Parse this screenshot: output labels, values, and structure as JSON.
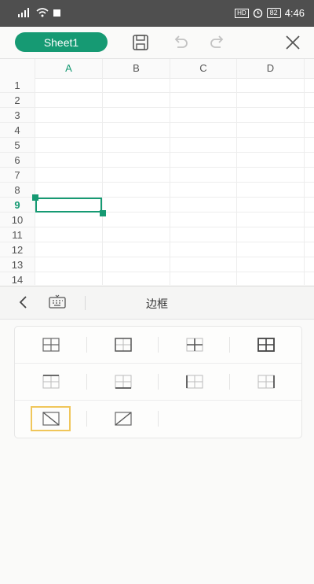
{
  "status_bar": {
    "battery": "82",
    "hd": "HD",
    "time": "4:46"
  },
  "toolbar": {
    "sheet_name": "Sheet1"
  },
  "grid": {
    "columns": [
      "A",
      "B",
      "C",
      "D"
    ],
    "rows": [
      "1",
      "2",
      "3",
      "4",
      "5",
      "6",
      "7",
      "8",
      "9",
      "10",
      "11",
      "12",
      "13",
      "14"
    ],
    "active_column": "A",
    "active_row": "9"
  },
  "panel": {
    "title": "边框"
  },
  "colors": {
    "accent": "#169a73",
    "selection_outline": "#f0c65a",
    "status_bar": "#4f4f4f"
  },
  "border_options": {
    "selected": "diagonal-down-border-option",
    "items": [
      "all-borders",
      "outer-borders",
      "inner-borders",
      "thick-outer-borders",
      "top-border",
      "bottom-border",
      "left-border",
      "right-border",
      "diagonal-down",
      "diagonal-up"
    ]
  }
}
